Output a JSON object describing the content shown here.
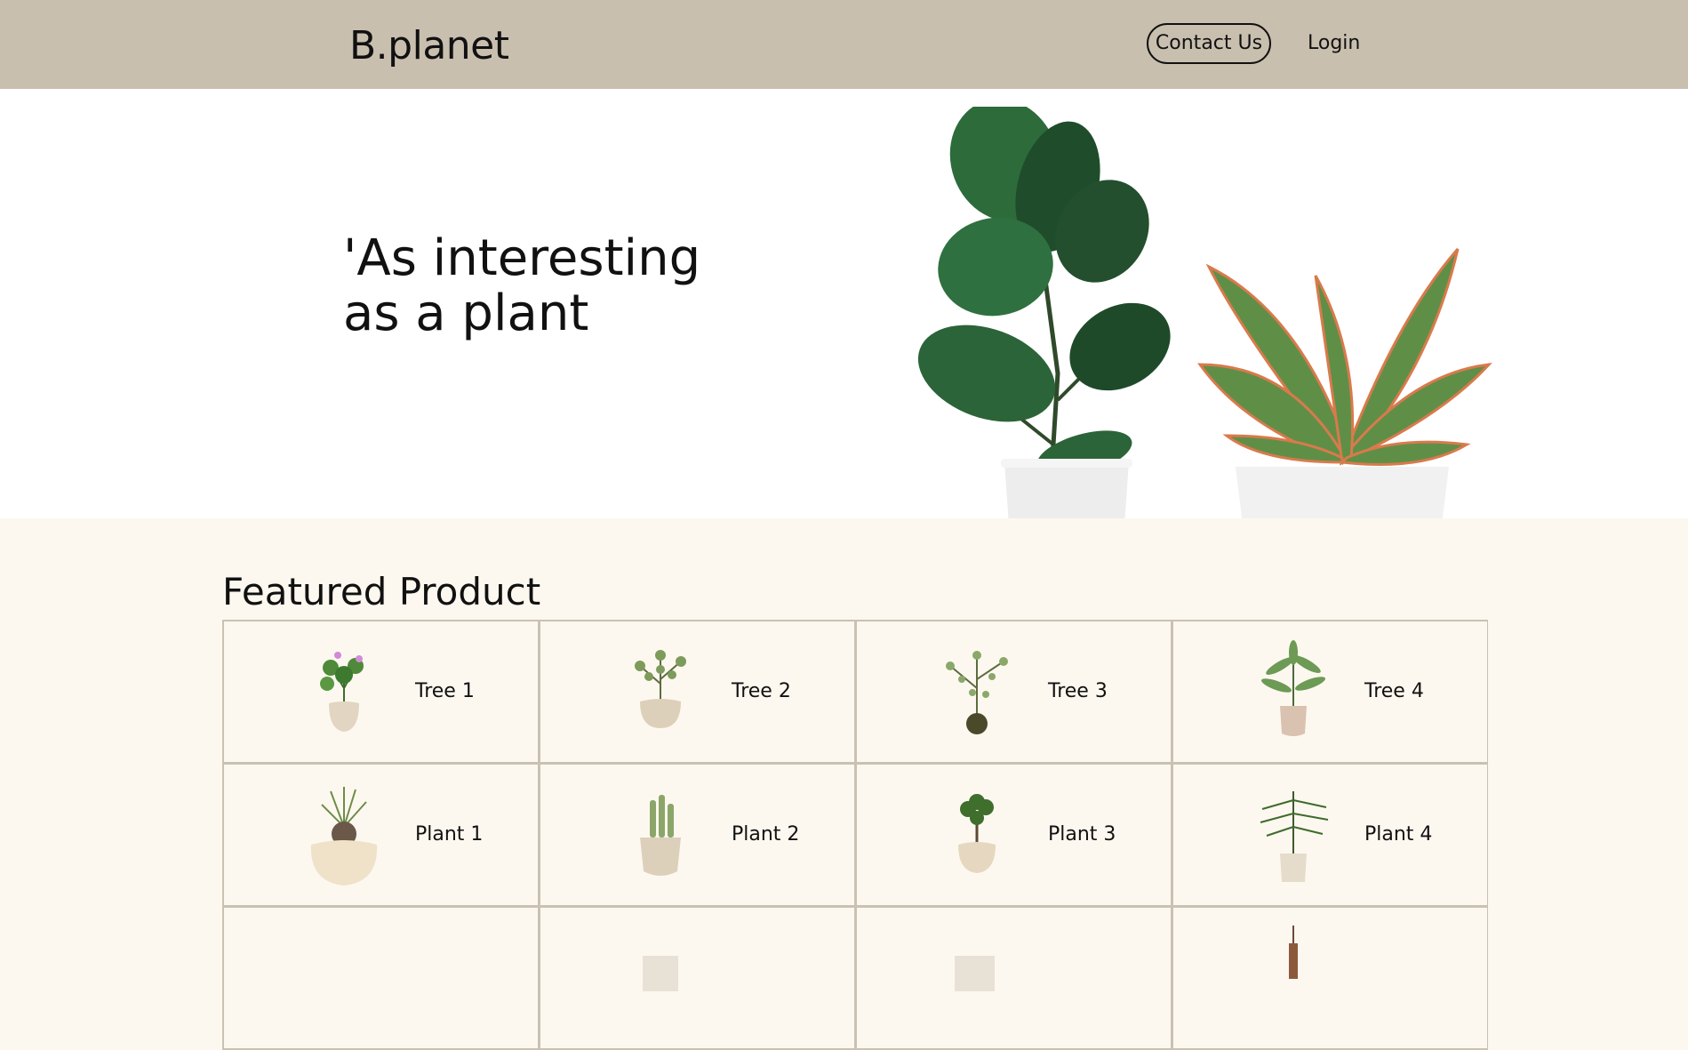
{
  "header": {
    "logo": "B.planet",
    "contact_label": "Contact Us",
    "login_label": "Login"
  },
  "hero": {
    "quote": "'As interesting\nas a plant"
  },
  "featured": {
    "title": "Featured Product",
    "items": [
      {
        "label": "Tree 1",
        "icon": "flower-plant-icon"
      },
      {
        "label": "Tree 2",
        "icon": "shrub-plant-icon"
      },
      {
        "label": "Tree 3",
        "icon": "kokedama-plant-icon"
      },
      {
        "label": "Tree 4",
        "icon": "palm-plant-icon"
      },
      {
        "label": "Plant 1",
        "icon": "caudex-plant-icon"
      },
      {
        "label": "Plant 2",
        "icon": "cactus-plant-icon"
      },
      {
        "label": "Plant 3",
        "icon": "bonsai-plant-icon"
      },
      {
        "label": "Plant 4",
        "icon": "fern-plant-icon"
      },
      {
        "label": "",
        "icon": "plant-icon"
      },
      {
        "label": "",
        "icon": "plant-icon"
      },
      {
        "label": "",
        "icon": "plant-icon"
      },
      {
        "label": "",
        "icon": "hanging-plant-icon"
      }
    ]
  },
  "colors": {
    "header_bg": "#c9bfaf",
    "section_bg": "#fdf8ef",
    "grid_border": "#c9c1b3"
  }
}
